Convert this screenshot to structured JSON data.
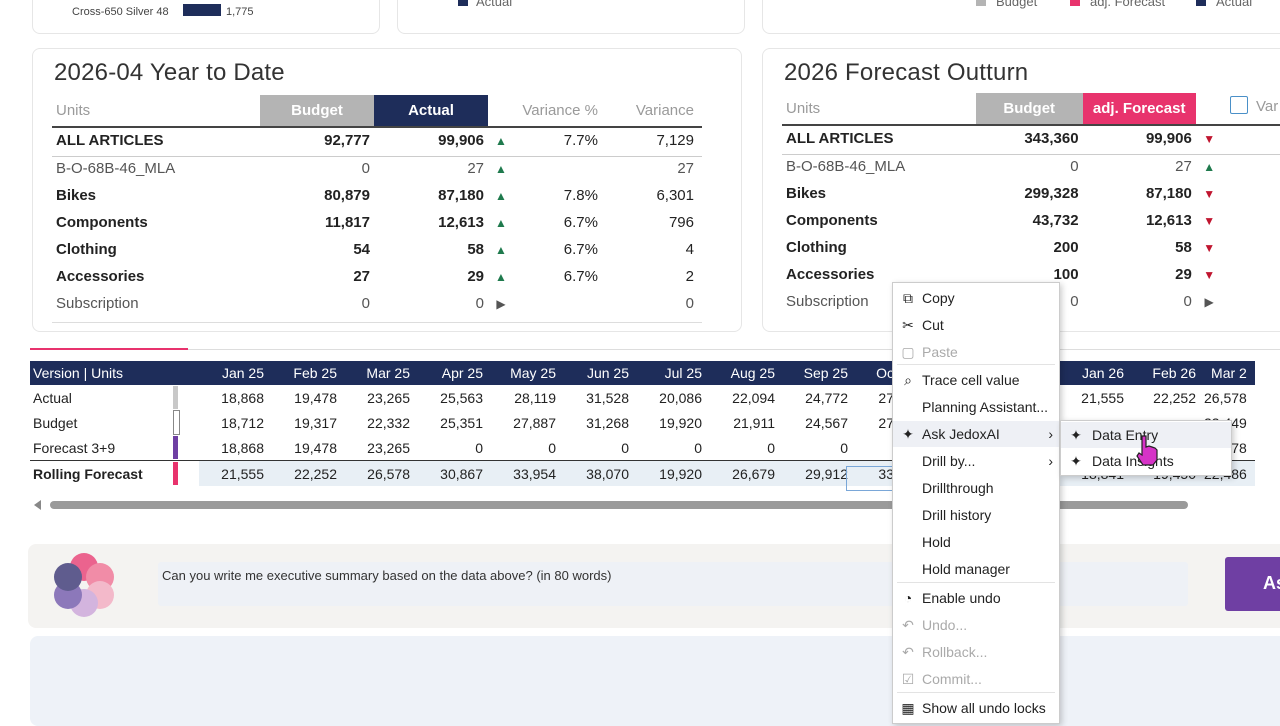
{
  "top_strip": {
    "cross_label": "Cross-650 Silver 48",
    "cross_value": "1,775",
    "legend_mid": "Actual",
    "legend_right": [
      "Budget",
      "adj. Forecast",
      "Actual"
    ]
  },
  "ytd": {
    "title": "2026-04 Year to Date",
    "headers": {
      "units": "Units",
      "budget": "Budget",
      "actual": "Actual",
      "var_pct": "Variance %",
      "var": "Variance"
    },
    "rows": [
      {
        "label": "ALL ARTICLES",
        "budget": "92,777",
        "actual": "99,906",
        "trend": "up",
        "var_pct": "7.7%",
        "var": "7,129",
        "style": "bold"
      },
      {
        "label": "B-O-68B-46_MLA",
        "budget": "0",
        "actual": "27",
        "trend": "up",
        "var_pct": "",
        "var": "27",
        "style": "sub"
      },
      {
        "label": "Bikes",
        "budget": "80,879",
        "actual": "87,180",
        "trend": "up",
        "var_pct": "7.8%",
        "var": "6,301",
        "style": "bold"
      },
      {
        "label": "Components",
        "budget": "11,817",
        "actual": "12,613",
        "trend": "up",
        "var_pct": "6.7%",
        "var": "796",
        "style": "bold"
      },
      {
        "label": "Clothing",
        "budget": "54",
        "actual": "58",
        "trend": "up",
        "var_pct": "6.7%",
        "var": "4",
        "style": "bold"
      },
      {
        "label": "Accessories",
        "budget": "27",
        "actual": "29",
        "trend": "up",
        "var_pct": "6.7%",
        "var": "2",
        "style": "bold"
      },
      {
        "label": "Subscription",
        "budget": "0",
        "actual": "0",
        "trend": "flat",
        "var_pct": "",
        "var": "0",
        "style": "sub"
      }
    ]
  },
  "outturn": {
    "title": "2026 Forecast Outturn",
    "headers": {
      "units": "Units",
      "budget": "Budget",
      "adj": "adj. Forecast",
      "var": "Var"
    },
    "rows": [
      {
        "label": "ALL ARTICLES",
        "budget": "343,360",
        "adj": "99,906",
        "trend": "down",
        "style": "bold"
      },
      {
        "label": "B-O-68B-46_MLA",
        "budget": "0",
        "adj": "27",
        "trend": "up",
        "style": "sub"
      },
      {
        "label": "Bikes",
        "budget": "299,328",
        "adj": "87,180",
        "trend": "down",
        "style": "bold"
      },
      {
        "label": "Components",
        "budget": "43,732",
        "adj": "12,613",
        "trend": "down",
        "style": "bold"
      },
      {
        "label": "Clothing",
        "budget": "200",
        "adj": "58",
        "trend": "down",
        "style": "bold"
      },
      {
        "label": "Accessories",
        "budget": "100",
        "adj": "29",
        "trend": "down",
        "style": "bold"
      },
      {
        "label": "Subscription",
        "budget": "0",
        "adj": "0",
        "trend": "flat",
        "style": "sub"
      }
    ]
  },
  "grid": {
    "header_label": "Version | Units",
    "months_left": [
      "Jan 25",
      "Feb 25",
      "Mar 25",
      "Apr 25",
      "May 25",
      "Jun 25",
      "Jul 25",
      "Aug 25",
      "Sep 25",
      "Oc"
    ],
    "months_right": [
      "Jan 26",
      "Feb 26",
      "Mar 2"
    ],
    "rows": [
      {
        "label": "Actual",
        "left": [
          "18,868",
          "19,478",
          "23,265",
          "25,563",
          "28,119",
          "31,528",
          "20,086",
          "22,094",
          "24,772",
          "27"
        ],
        "right": [
          "21,555",
          "22,252",
          "26,578"
        ]
      },
      {
        "label": "Budget",
        "left": [
          "18,712",
          "19,317",
          "22,332",
          "25,351",
          "27,887",
          "31,268",
          "19,920",
          "21,911",
          "24,567",
          "27"
        ],
        "right": [
          "",
          "",
          "23,449"
        ]
      },
      {
        "label": "Forecast 3+9",
        "left": [
          "18,868",
          "19,478",
          "23,265",
          "0",
          "0",
          "0",
          "0",
          "0",
          "0",
          ""
        ],
        "right": [
          "",
          "",
          "26,578"
        ]
      },
      {
        "label": "Rolling Forecast",
        "left": [
          "21,555",
          "22,252",
          "26,578",
          "30,867",
          "33,954",
          "38,070",
          "19,920",
          "26,679",
          "29,912",
          "33"
        ],
        "right": [
          "18,841",
          "19,450",
          "22,486"
        ]
      }
    ]
  },
  "ai": {
    "prompt": "Can you write me executive summary based on the data above? (in 80 words)",
    "ask_label": "As"
  },
  "context_menu": {
    "items": {
      "copy": "Copy",
      "cut": "Cut",
      "paste": "Paste",
      "trace": "Trace cell value",
      "planning": "Planning Assistant...",
      "ask_ai": "Ask JedoxAI",
      "drill_by": "Drill by...",
      "drillthrough": "Drillthrough",
      "drill_history": "Drill history",
      "hold": "Hold",
      "hold_manager": "Hold manager",
      "enable_undo": "Enable undo",
      "undo": "Undo...",
      "rollback": "Rollback...",
      "commit": "Commit...",
      "show_locks": "Show all undo locks"
    },
    "submenu": {
      "data_entry": "Data Entry",
      "data_insights": "Data Insights"
    }
  },
  "colors": {
    "navy": "#1e2d5a",
    "pink": "#e8336d",
    "grey": "#b4b4b4",
    "green": "#1f7a4d",
    "red": "#c0152f"
  }
}
